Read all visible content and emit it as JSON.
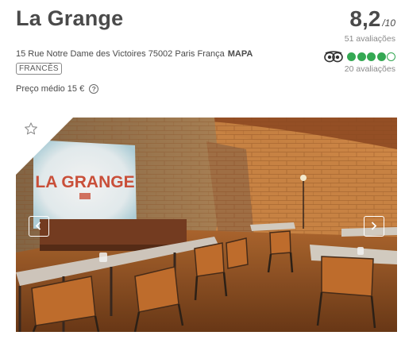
{
  "restaurant": {
    "name": "La Grange",
    "address": "15 Rue Notre Dame des Victoires 75002 Paris França",
    "map_link": "MAPA",
    "cuisine": "FRANCÊS",
    "price": "Preço médio 15 €"
  },
  "rating": {
    "score": "8,2",
    "out_of": "/10",
    "reviews": "51 avaliações"
  },
  "tripadvisor": {
    "bubbles_filled": 4,
    "bubbles_total": 5,
    "reviews": "20 avaliações",
    "color": "#34a853"
  },
  "photo": {
    "sign_text": "LA GRANGE"
  },
  "icons": {
    "favorite": "star-outline-icon",
    "prev": "chevron-left-icon",
    "next": "chevron-right-icon",
    "info": "help-icon",
    "tripadvisor": "owl-icon"
  }
}
